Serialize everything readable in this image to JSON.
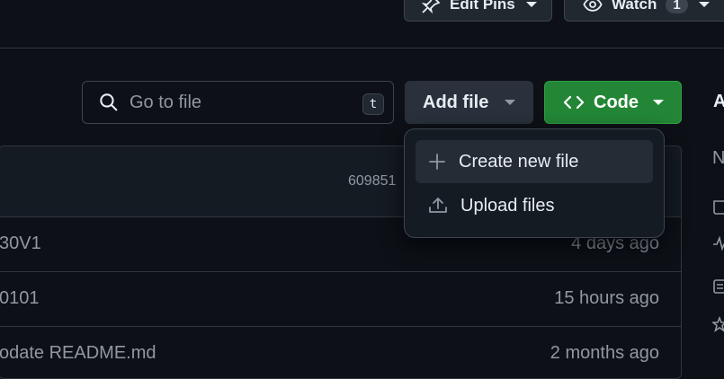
{
  "header": {
    "edit_pins_label": "Edit Pins",
    "watch_label": "Watch",
    "watch_count": "1"
  },
  "toolbar": {
    "search_placeholder": "Go to file",
    "search_shortcut": "t",
    "add_file_label": "Add file",
    "code_label": "Code"
  },
  "sidebar": {
    "about_title_partial": "A",
    "about_description_partial": "N"
  },
  "latest_commit": {
    "hash_partial": "609851"
  },
  "file_rows": [
    {
      "message": "30V1",
      "date": "4 days ago"
    },
    {
      "message": "0101",
      "date": "15 hours ago"
    },
    {
      "message": "odate README.md",
      "date": "2 months ago"
    }
  ],
  "add_file_menu": {
    "items": [
      {
        "label": "Create new file",
        "icon": "plus-icon"
      },
      {
        "label": "Upload files",
        "icon": "upload-icon"
      }
    ]
  },
  "colors": {
    "background": "#0d1117",
    "code_button": "#238636",
    "border": "#30363d",
    "muted_text": "#9198a1"
  }
}
